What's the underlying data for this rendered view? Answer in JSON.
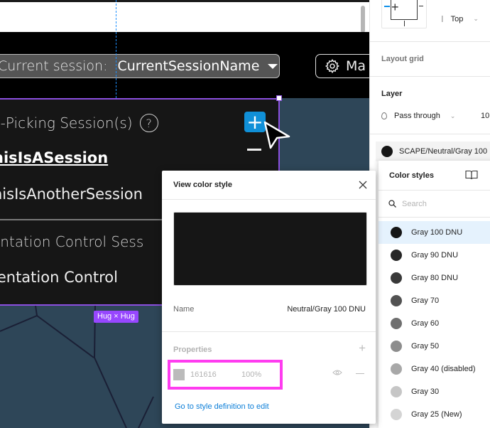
{
  "canvas": {
    "session_dropdown": {
      "label": "Current session:",
      "value": "CurrentSessionName"
    },
    "manage_button_label": "Ma",
    "panel": {
      "picking_title": "n-Picking Session(s)",
      "help_glyph": "?",
      "sessions": [
        "hisIsASession",
        "hisIsAnotherSession"
      ],
      "orientation_title": "entation Control Sess",
      "orientation_item": "ientation Control",
      "add_glyph": "+"
    },
    "size_badge": "Hug × Hug"
  },
  "modal": {
    "title": "View color style",
    "swatch_color": "#161616",
    "name_label": "Name",
    "name_value": "Neutral/Gray 100 DNU",
    "properties_label": "Properties",
    "property": {
      "hex": "161616",
      "opacity": "100%"
    },
    "edit_link": "Go to style definition to edit"
  },
  "right_panel": {
    "vertical_constraint": "Top",
    "layout_grid_label": "Layout grid",
    "layer_label": "Layer",
    "blend_mode": "Pass through",
    "opacity": "10",
    "fill_style": "SCAPE/Neutral/Gray 100"
  },
  "color_styles": {
    "title": "Color styles",
    "search_placeholder": "Search",
    "items": [
      {
        "name": "Gray 100 DNU",
        "color": "#161616",
        "selected": true
      },
      {
        "name": "Gray 90 DNU",
        "color": "#262626"
      },
      {
        "name": "Gray 80 DNU",
        "color": "#393939"
      },
      {
        "name": "Gray 70",
        "color": "#525252"
      },
      {
        "name": "Gray 60",
        "color": "#6f6f6f"
      },
      {
        "name": "Gray 50",
        "color": "#8d8d8d"
      },
      {
        "name": "Gray 40 (disabled)",
        "color": "#a8a8a8"
      },
      {
        "name": "Gray 30",
        "color": "#c6c6c6"
      },
      {
        "name": "Gray 25 (New)",
        "color": "#d4d4d4"
      }
    ]
  },
  "colors": {
    "selection_purple": "#8b4fe0",
    "badge_purple": "#9747ff",
    "highlight_magenta": "#ff3cf0",
    "link_blue": "#0d7fd8",
    "add_button_blue": "#1090d8"
  }
}
